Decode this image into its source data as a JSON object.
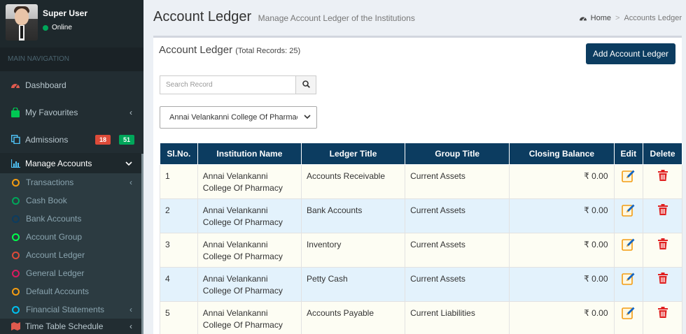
{
  "user": {
    "name": "Super User",
    "status": "Online"
  },
  "nav": {
    "header": "MAIN NAVIGATION",
    "items": [
      {
        "label": "Dashboard",
        "icon": "dashboard-icon"
      },
      {
        "label": "My Favourites",
        "icon": "shopping-bag-icon"
      },
      {
        "label": "Admissions",
        "icon": "copy-icon",
        "badge_red": "18",
        "badge_green": "51"
      },
      {
        "label": "Manage Accounts",
        "icon": "bar-chart-icon"
      }
    ],
    "sub_items": [
      {
        "label": "Transactions",
        "color": "#f39c12"
      },
      {
        "label": "Cash Book",
        "color": "#00a65a"
      },
      {
        "label": "Bank Accounts",
        "color": "#0c3c60"
      },
      {
        "label": "Account Group",
        "color": "#00ff4c"
      },
      {
        "label": "Account Ledger",
        "color": "#dd4b39"
      },
      {
        "label": "General Ledger",
        "color": "#d81b60"
      },
      {
        "label": "Default Accounts",
        "color": "#f39c12"
      },
      {
        "label": "Financial Statements",
        "color": "#00c0ef"
      }
    ],
    "bottom_item": {
      "label": "Time Table Schedule",
      "icon": "map-icon"
    }
  },
  "header": {
    "title": "Account Ledger",
    "subtitle": "Manage Account Ledger of the Institutions",
    "breadcrumb_home": "Home",
    "breadcrumb_current": "Accounts Ledger"
  },
  "box": {
    "title": "Account Ledger",
    "records": "(Total Records: 25)",
    "add_button": "Add Account Ledger",
    "search_placeholder": "Search Record",
    "institution_selected": "Annai Velankanni College Of Pharmacy"
  },
  "table": {
    "headers": [
      "Sl.No.",
      "Institution Name",
      "Ledger Title",
      "Group Title",
      "Closing Balance",
      "Edit",
      "Delete"
    ],
    "rows": [
      {
        "sl": "1",
        "institution": "Annai Velankanni College Of Pharmacy",
        "ledger": "Accounts Receivable",
        "group": "Current Assets",
        "balance": "₹ 0.00"
      },
      {
        "sl": "2",
        "institution": "Annai Velankanni College Of Pharmacy",
        "ledger": "Bank Accounts",
        "group": "Current Assets",
        "balance": "₹ 0.00"
      },
      {
        "sl": "3",
        "institution": "Annai Velankanni College Of Pharmacy",
        "ledger": "Inventory",
        "group": "Current Assets",
        "balance": "₹ 0.00"
      },
      {
        "sl": "4",
        "institution": "Annai Velankanni College Of Pharmacy",
        "ledger": "Petty Cash",
        "group": "Current Assets",
        "balance": "₹ 0.00"
      },
      {
        "sl": "5",
        "institution": "Annai Velankanni College Of Pharmacy",
        "ledger": "Accounts Payable",
        "group": "Current Liabilities",
        "balance": "₹ 0.00"
      }
    ]
  }
}
